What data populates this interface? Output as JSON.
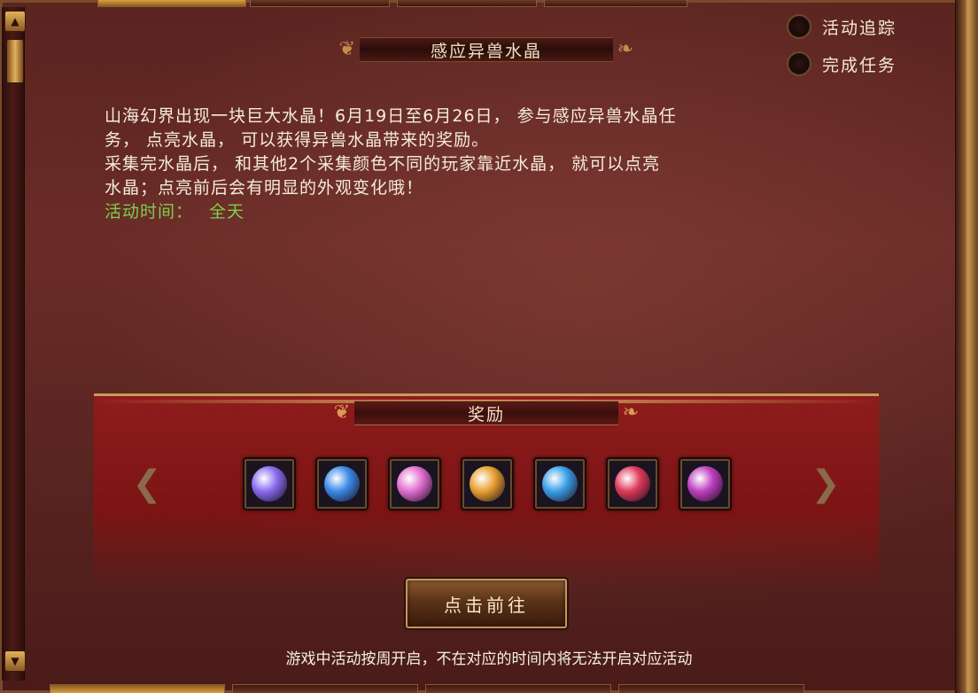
{
  "title": "感应异兽水晶",
  "toggles": [
    {
      "label": "活动追踪"
    },
    {
      "label": "完成任务"
    }
  ],
  "description": {
    "lines": [
      "山海幻界出现一块巨大水晶！6月19日至6月26日， 参与感应异兽水晶任",
      "务， 点亮水晶， 可以获得异兽水晶带来的奖励。",
      "采集完水晶后， 和其他2个采集颜色不同的玩家靠近水晶， 就可以点亮",
      "水晶；点亮前后会有明显的外观变化哦！"
    ],
    "time_label": "活动时间：",
    "time_value": "全天"
  },
  "rewards": {
    "title": "奖励",
    "items": [
      {
        "icon": "purple-lucky-bag-icon",
        "color": "#8a6cf0"
      },
      {
        "icon": "blue-crystal-orb-icon",
        "color": "#3a8ae8"
      },
      {
        "icon": "pink-crystal-orb-icon",
        "color": "#e070d0"
      },
      {
        "icon": "gold-eggs-icon",
        "color": "#e8a030"
      },
      {
        "icon": "blue-eggs-icon",
        "color": "#3aa0e8"
      },
      {
        "icon": "red-gem-icon",
        "color": "#e03a5a"
      },
      {
        "icon": "purple-orb-icon",
        "color": "#c040c0"
      }
    ]
  },
  "buttons": {
    "go": "点击前往"
  },
  "notice": "游戏中活动按周开启，不在对应的时间内将无法开启对应活动"
}
